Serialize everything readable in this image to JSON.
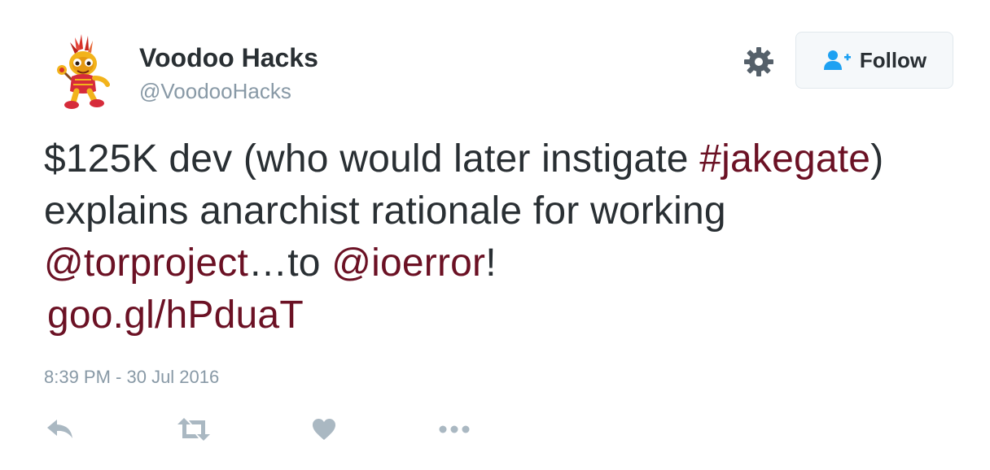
{
  "user": {
    "display_name": "Voodoo Hacks",
    "screen_name": "@VoodooHacks",
    "avatar_icon": "voodoo-doll-avatar"
  },
  "header": {
    "settings_icon": "gear-icon",
    "follow_button": {
      "label": "Follow",
      "icon": "add-user-icon"
    }
  },
  "tweet": {
    "segments": {
      "t1": "$125K dev (who would later instigate ",
      "hashtag": "#jakegate",
      "t2": ") explains anarchist rationale for working ",
      "mention1": "@torproject",
      "t3": "…to ",
      "mention2": "@ioerror",
      "t4": "!",
      "link": "goo.gl/hPduaT"
    },
    "timestamp": "8:39 PM - 30 Jul 2016"
  },
  "actions": [
    {
      "name": "reply",
      "icon": "reply-icon"
    },
    {
      "name": "retweet",
      "icon": "retweet-icon"
    },
    {
      "name": "like",
      "icon": "heart-icon"
    },
    {
      "name": "more",
      "icon": "more-icon"
    }
  ],
  "colors": {
    "link": "#6b1124",
    "text": "#292f33",
    "muted": "#8899a6",
    "follow_icon": "#1da1f2",
    "action_icons": "#aab8c2"
  }
}
